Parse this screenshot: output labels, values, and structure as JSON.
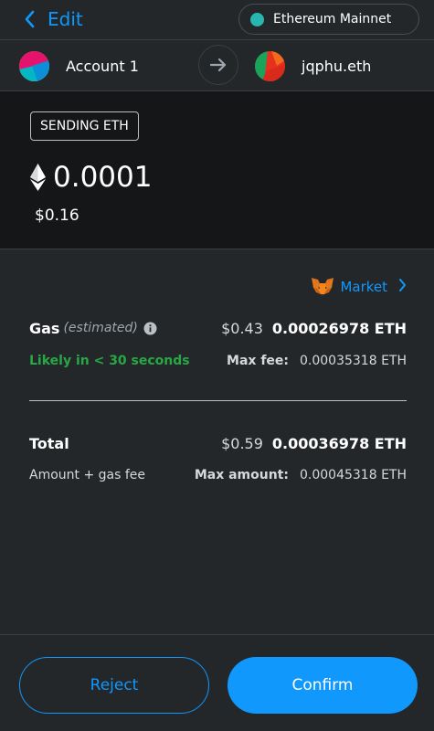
{
  "header": {
    "back_label": "Edit",
    "network_label": "Ethereum Mainnet",
    "network_color": "#29b6af"
  },
  "accounts": {
    "from_label": "Account 1",
    "to_label": "jqphu.eth",
    "arrow_icon": "arrow-right-icon"
  },
  "summary": {
    "badge": "SENDING ETH",
    "amount": "0.0001",
    "fiat": "$0.16",
    "currency_icon": "ethereum-icon"
  },
  "market": {
    "label": "Market",
    "icon": "fox-icon"
  },
  "gas": {
    "label": "Gas",
    "label_note": "(estimated)",
    "fiat": "$0.43",
    "eth": "0.00026978 ETH",
    "likely": "Likely in < 30 seconds",
    "max_fee_label": "Max fee:",
    "max_fee_value": "0.00035318 ETH"
  },
  "total": {
    "label": "Total",
    "fiat": "$0.59",
    "eth": "0.00036978 ETH",
    "sub_label": "Amount + gas fee",
    "max_amount_label": "Max amount:",
    "max_amount_value": "0.00045318 ETH"
  },
  "buttons": {
    "reject": "Reject",
    "confirm": "Confirm"
  },
  "colors": {
    "accent": "#1098fc",
    "success": "#28a745",
    "background": "#24272a",
    "summary_background": "#141618"
  }
}
